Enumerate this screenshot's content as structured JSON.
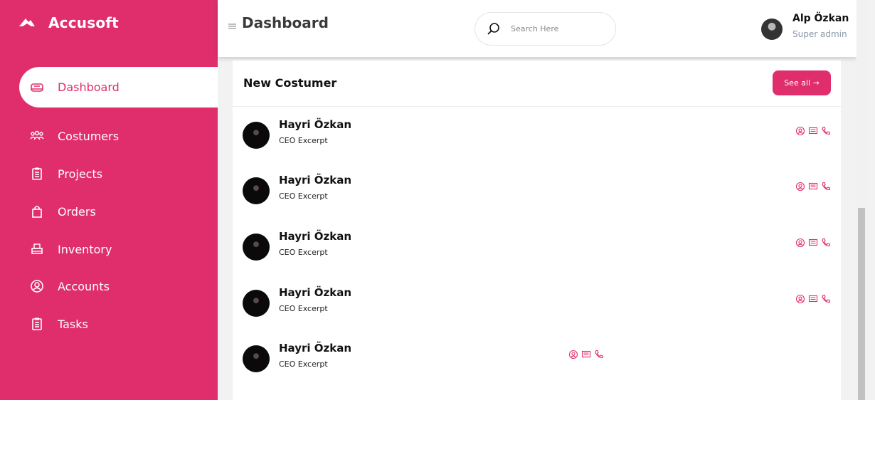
{
  "brand": {
    "name": "Accusoft"
  },
  "sidebar": {
    "items": [
      {
        "label": "Dashboard",
        "icon": "dashboard-icon",
        "active": true
      },
      {
        "label": "Costumers",
        "icon": "users-icon"
      },
      {
        "label": "Projects",
        "icon": "clipboard-icon"
      },
      {
        "label": "Orders",
        "icon": "shopping-bag-icon"
      },
      {
        "label": "Inventory",
        "icon": "inventory-icon"
      },
      {
        "label": "Accounts",
        "icon": "account-icon"
      },
      {
        "label": "Tasks",
        "icon": "tasks-icon"
      }
    ]
  },
  "header": {
    "title": "Dashboard",
    "search_placeholder": "Search Here"
  },
  "user": {
    "name": "Alp Özkan",
    "role": "Super admin"
  },
  "customers": {
    "title": "New Costumer",
    "see_all_label": "See all →",
    "rows": [
      {
        "name": "Hayri Özkan",
        "title": "CEO Excerpt"
      },
      {
        "name": "Hayri Özkan",
        "title": "CEO Excerpt"
      },
      {
        "name": "Hayri Özkan",
        "title": "CEO Excerpt"
      },
      {
        "name": "Hayri Özkan",
        "title": "CEO Excerpt"
      },
      {
        "name": "Hayri Özkan",
        "title": "CEO Excerpt"
      }
    ]
  },
  "colors": {
    "accent": "#e02e6c",
    "text": "#111111",
    "muted": "#8a97a8"
  }
}
